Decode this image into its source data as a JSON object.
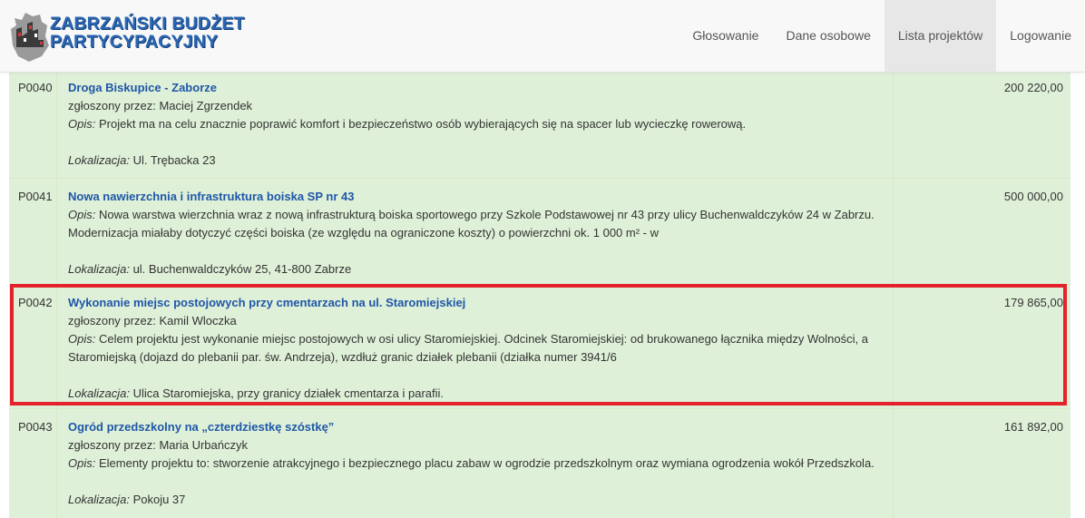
{
  "brand": {
    "line1": "ZABRZAŃSKI BUDŻET",
    "line2": "PARTYCYPACYJNY",
    "logo_icon": "city-crest-icon"
  },
  "nav": {
    "items": [
      {
        "label": "Głosowanie"
      },
      {
        "label": "Dane osobowe"
      },
      {
        "label": "Lista projektów",
        "active": true
      },
      {
        "label": "Logowanie"
      }
    ]
  },
  "projects": [
    {
      "id": "P0040",
      "title": "Droga Biskupice - Zaborze",
      "submitted_label": "zgłoszony przez:",
      "submitted_by": "Maciej Zgrzendek",
      "desc_label": "Opis:",
      "description_lines": [
        "Projekt ma na celu znacznie poprawić komfort i bezpieczeństwo osób wybierających się na spacer lub wycieczkę rowerową."
      ],
      "loc_label": "Lokalizacja:",
      "location": "Ul. Trębacka 23",
      "amount": "200 220,00"
    },
    {
      "id": "P0041",
      "title": "Nowa nawierzchnia i infrastruktura boiska SP nr 43",
      "submitted_label": "",
      "submitted_by": "",
      "desc_label": "Opis:",
      "description_lines": [
        "Nowa warstwa wierzchnia wraz z nową infrastrukturą boiska sportowego przy Szkole Podstawowej nr 43 przy ulicy Buchenwaldczyków 24 w Zabrzu.",
        "Modernizacja miałaby dotyczyć części boiska (ze względu na ograniczone koszty) o powierzchni ok. 1 000 m² - w"
      ],
      "loc_label": "Lokalizacja:",
      "location": "ul. Buchenwaldczyków 25, 41-800 Zabrze",
      "amount": "500 000,00"
    },
    {
      "id": "P0042",
      "title": "Wykonanie miejsc postojowych przy cmentarzach na ul. Staromiejskiej",
      "submitted_label": "zgłoszony przez:",
      "submitted_by": "Kamil Wloczka",
      "desc_label": "Opis:",
      "description_lines": [
        "Celem projektu jest wykonanie miejsc postojowych w osi ulicy Staromiejskiej. Odcinek Staromiejskiej: od brukowanego łącznika między Wolności, a",
        "Staromiejską (dojazd do plebanii par. św. Andrzeja), wzdłuż granic działek plebanii (działka numer 3941/6"
      ],
      "loc_label": "Lokalizacja:",
      "location": "Ulica Staromiejska, przy granicy działek cmentarza i parafii.",
      "amount": "179 865,00"
    },
    {
      "id": "P0043",
      "title": "Ogród przedszkolny na „czterdziestkę szóstkę”",
      "submitted_label": "zgłoszony przez:",
      "submitted_by": "Maria Urbańczyk",
      "desc_label": "Opis:",
      "description_lines": [
        "Elementy projektu to: stworzenie atrakcyjnego i bezpiecznego placu zabaw w ogrodzie przedszkolnym oraz wymiana ogrodzenia wokół Przedszkola."
      ],
      "loc_label": "Lokalizacja:",
      "location": "Pokoju 37",
      "amount": "161 892,00"
    }
  ],
  "colors": {
    "row_bg": "#dff0d8",
    "title_link": "#1f57a8",
    "highlight_border": "#e3222b",
    "navbar_bg": "#f8f8f8"
  }
}
